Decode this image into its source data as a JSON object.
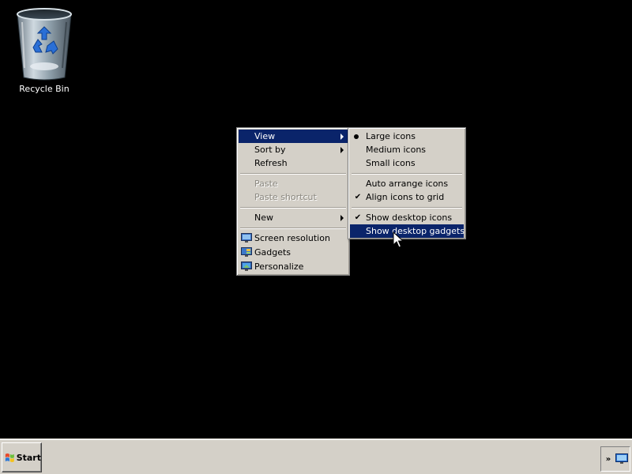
{
  "desktop": {
    "background": "#000000",
    "icons": [
      {
        "label": "Recycle Bin",
        "icon": "recycle-bin-icon"
      }
    ]
  },
  "context_menu": {
    "items": [
      {
        "label": "View",
        "has_submenu": true,
        "highlighted": true
      },
      {
        "label": "Sort by",
        "has_submenu": true
      },
      {
        "label": "Refresh"
      },
      {
        "label": "Paste",
        "disabled": true
      },
      {
        "label": "Paste shortcut",
        "disabled": true
      },
      {
        "label": "New",
        "has_submenu": true
      },
      {
        "label": "Screen resolution",
        "icon": "screen-resolution-icon"
      },
      {
        "label": "Gadgets",
        "icon": "gadgets-icon"
      },
      {
        "label": "Personalize",
        "icon": "personalize-icon"
      }
    ]
  },
  "view_submenu": {
    "items": [
      {
        "label": "Large icons",
        "radio_selected": true
      },
      {
        "label": "Medium icons"
      },
      {
        "label": "Small icons"
      },
      {
        "label": "Auto arrange icons"
      },
      {
        "label": "Align icons to grid",
        "checked": true
      },
      {
        "label": "Show desktop icons",
        "checked": true
      },
      {
        "label": "Show desktop gadgets",
        "highlighted": true
      }
    ]
  },
  "taskbar": {
    "start_label": "Start",
    "tray_chevron": "»",
    "tray_icons": [
      "network-monitor-icon"
    ]
  },
  "colors": {
    "menu_bg": "#d4d0c8",
    "highlight": "#0a246a",
    "highlight_text": "#ffffff",
    "disabled_text": "#8a877f"
  }
}
